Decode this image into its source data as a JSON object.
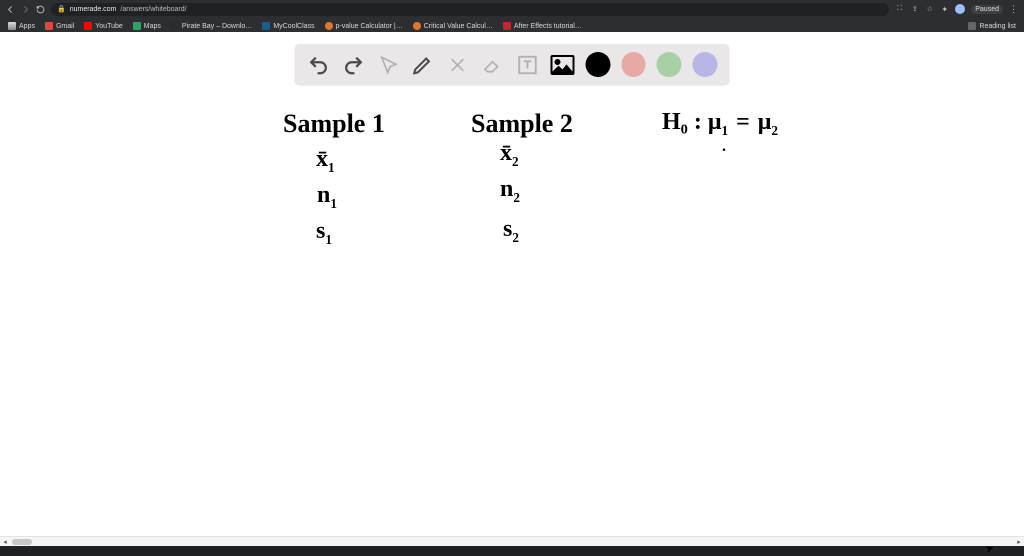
{
  "chrome": {
    "nav": {
      "url_host": "numerade.com",
      "url_path": "/answers/whiteboard/"
    },
    "right": {
      "paused_label": "Paused"
    },
    "bookmarks": [
      {
        "label": "Apps",
        "color": "#4f4f4f"
      },
      {
        "label": "Gmail",
        "color": "#d84c3e"
      },
      {
        "label": "YouTube",
        "color": "#ff0200"
      },
      {
        "label": "Maps",
        "color": "#2ea262"
      },
      {
        "label": "Pirate Bay – Downlo…",
        "color": "#2b2b2b"
      },
      {
        "label": "MyCoolClass",
        "color": "#155e93"
      },
      {
        "label": "p-value Calculator |…",
        "color": "#e0782c"
      },
      {
        "label": "Critical Value Calcul…",
        "color": "#e0782c"
      },
      {
        "label": "After Effects tutorial…",
        "color": "#c1272d"
      }
    ],
    "reading_list_label": "Reading list"
  },
  "toolbar": {
    "colors": {
      "black": "#000000",
      "red": "#e8a8a6",
      "green": "#a8cfa6",
      "purple": "#b8b6e6"
    }
  },
  "handwriting": {
    "col1_title": "Sample 1",
    "col1_x": "x̄",
    "col1_x_sub": "1",
    "col1_n": "n",
    "col1_n_sub": "1",
    "col1_s": "s",
    "col1_s_sub": "1",
    "col2_title": "Sample 2",
    "col2_x": "x̄",
    "col2_x_sub": "2",
    "col2_n": "n",
    "col2_n_sub": "2",
    "col2_s": "s",
    "col2_s_sub": "2",
    "hyp_label": "H₀ :",
    "hyp_mu1": "μ",
    "hyp_mu1_sub": "1",
    "hyp_eq": "=",
    "hyp_mu2": "μ",
    "hyp_mu2_sub": "2"
  }
}
